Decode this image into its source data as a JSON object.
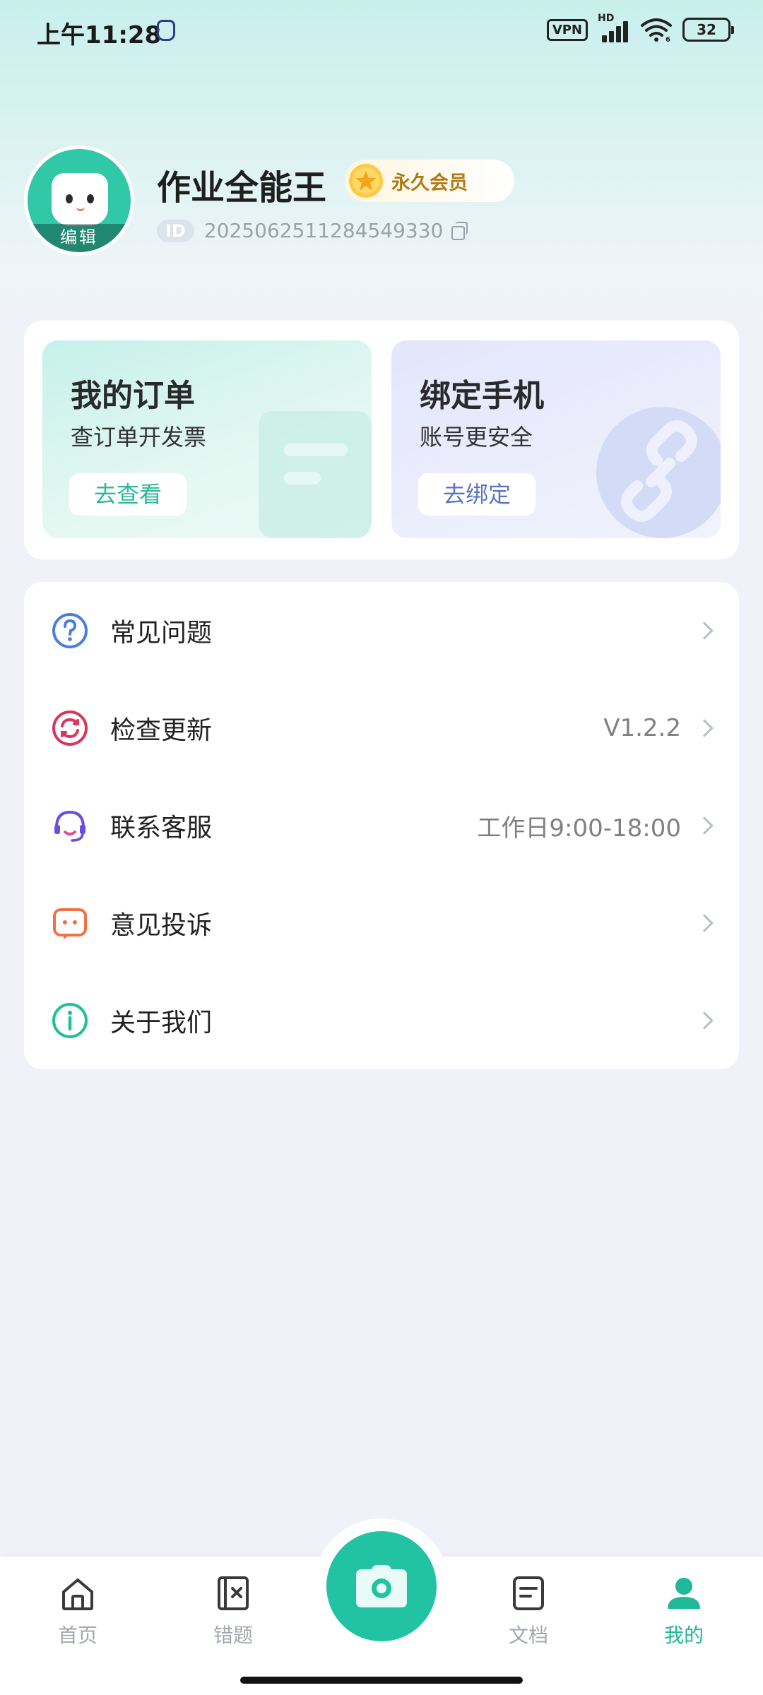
{
  "status_bar": {
    "time": "上午11:28",
    "vpn": "VPN",
    "network": "HD",
    "wifi_label": "6",
    "battery": "32"
  },
  "profile": {
    "name": "作业全能王",
    "badge": "永久会员",
    "id_tag": "ID",
    "id_number": "20250625112845493​30",
    "avatar_edit": "编辑"
  },
  "cards": {
    "order": {
      "title": "我的订单",
      "subtitle": "查订单开发票",
      "button": "去查看"
    },
    "bind": {
      "title": "绑定手机",
      "subtitle": "账号更安全",
      "button": "去绑定"
    }
  },
  "menu": [
    {
      "label": "常见问题",
      "value": "",
      "icon": "question-circle-icon",
      "color": "#4a7de0"
    },
    {
      "label": "检查更新",
      "value": "V1.2.2",
      "icon": "refresh-circle-icon",
      "color": "#d9355f"
    },
    {
      "label": "联系客服",
      "value": "工作日9:00-18:00",
      "icon": "headset-icon",
      "color": "#6a4ee0"
    },
    {
      "label": "意见投诉",
      "value": "",
      "icon": "chat-bubble-icon",
      "color": "#ee7247"
    },
    {
      "label": "关于我们",
      "value": "",
      "icon": "info-circle-icon",
      "color": "#1fbf98"
    }
  ],
  "nav": {
    "home": "首页",
    "mistakes": "错题",
    "docs": "文档",
    "mine": "我的",
    "active": "我的",
    "accent": "#1fb99a"
  }
}
